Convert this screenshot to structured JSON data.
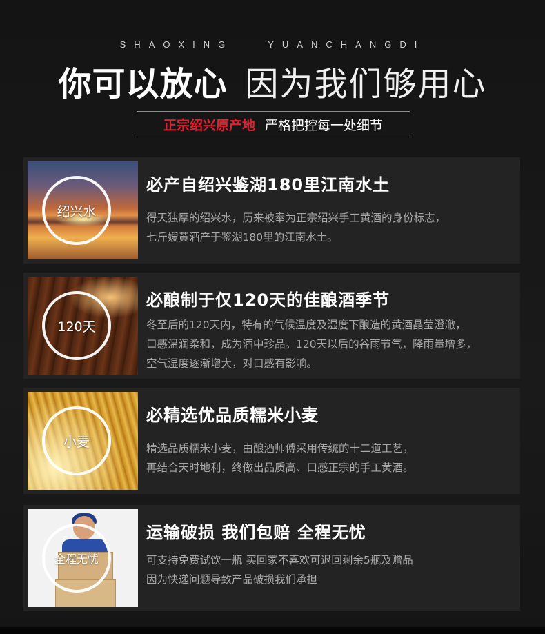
{
  "header": {
    "en_left": "SHAOXING",
    "en_right": "YUANCHANGDI",
    "headline_bold": "你可以放心",
    "headline_thin": "因为我们够用心",
    "tagline_red": "正宗绍兴原产地",
    "tagline_white": "严格把控每一处细节"
  },
  "cards": [
    {
      "badge": "绍兴水",
      "title": "必产自绍兴鉴湖180里江南水土",
      "lines": [
        "得天独厚的绍兴水，历来被奉为正宗绍兴手工黄酒的身份标志，",
        "七斤嫂黄酒产于鉴湖180里的江南水土。"
      ]
    },
    {
      "badge": "120天",
      "title": "必酿制于仅120天的佳酿酒季节",
      "lines": [
        "冬至后的120天内，特有的气候温度及湿度下酿造的黄酒晶莹澄澈，",
        "口感温润柔和，成为酒中珍品。120天以后的谷雨节气，降雨量增多，",
        "空气湿度逐渐增大，对口感有影响。"
      ]
    },
    {
      "badge": "小麦",
      "title": "必精选优品质糯米小麦",
      "lines": [
        "精选品质糯米小麦，由酿酒师傅采用传统的十二道工艺，",
        "再结合天时地利，终做出品质高、口感正宗的手工黄酒。"
      ]
    },
    {
      "badge": "全程无忧",
      "title": "运输破损 我们包赔 全程无忧",
      "lines": [
        "可支持免费试饮一瓶 买回家不喜欢可退回剩余5瓶及赠品",
        "因为快递问题导致产品破损我们承担"
      ]
    }
  ]
}
